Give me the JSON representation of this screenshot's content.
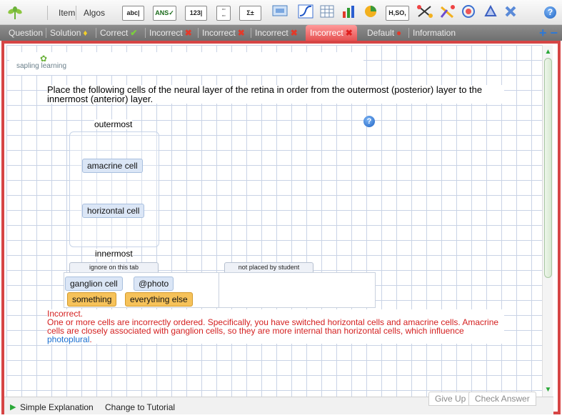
{
  "toolbar": {
    "item_label": "Item",
    "algos_label": "Algos",
    "tools": [
      "abc|",
      "ANS✓",
      "123|",
      "H,SO,"
    ],
    "help_glyph": "?"
  },
  "tabs": [
    {
      "label": "Question",
      "icon": ""
    },
    {
      "label": "Solution",
      "icon": "lightbulb-icon"
    },
    {
      "label": "Correct",
      "icon": "check-icon"
    },
    {
      "label": "Incorrect",
      "icon": "x-icon"
    },
    {
      "label": "Incorrect",
      "icon": "x-icon"
    },
    {
      "label": "Incorrect",
      "icon": "x-icon"
    },
    {
      "label": "Incorrect",
      "icon": "x-icon"
    },
    {
      "label": "Default",
      "icon": "minus-circle-icon"
    },
    {
      "label": "Information",
      "icon": ""
    }
  ],
  "tab_icons": {
    "x": "✖",
    "check": "✔",
    "bulb": "💡",
    "minus": "●"
  },
  "tab_plus_minus": "+ −",
  "logo": {
    "text": "sapling learning"
  },
  "question": {
    "text": "Place the following cells of the neural layer of the retina in order from the outermost (posterior) layer to the innermost (anterior) layer.",
    "help_glyph": "?"
  },
  "ordering": {
    "top_label": "outermost",
    "bottom_label": "innermost",
    "items": [
      "amacrine cell",
      "horizontal cell"
    ]
  },
  "pools": {
    "ignore_header": "ignore on this tab",
    "ignore_items": [
      "ganglion cell",
      "@photo"
    ],
    "ignore_orange_items": [
      "something",
      "everything else"
    ],
    "not_placed_header": "not placed by student"
  },
  "feedback": {
    "title": "Incorrect.",
    "body": "One or more cells are incorrectly ordered. Specifically, you have switched horizontal cells and amacrine cells. Amacrine cells are closely associated with ganglion cells, so they are more internal than horizontal cells, which influence ",
    "link": "photoplural",
    "end": "."
  },
  "bottom": {
    "simple_explanation": "Simple Explanation",
    "change_to_tutorial": "Change to Tutorial",
    "give_up": "Give Up",
    "check_answer": "Check Answer"
  },
  "colors": {
    "accent_red": "#d64545",
    "link_blue": "#1a6fd0",
    "feedback_red": "#d42020",
    "chip_blue": "#dbe6f6",
    "chip_orange": "#f6c25a"
  }
}
